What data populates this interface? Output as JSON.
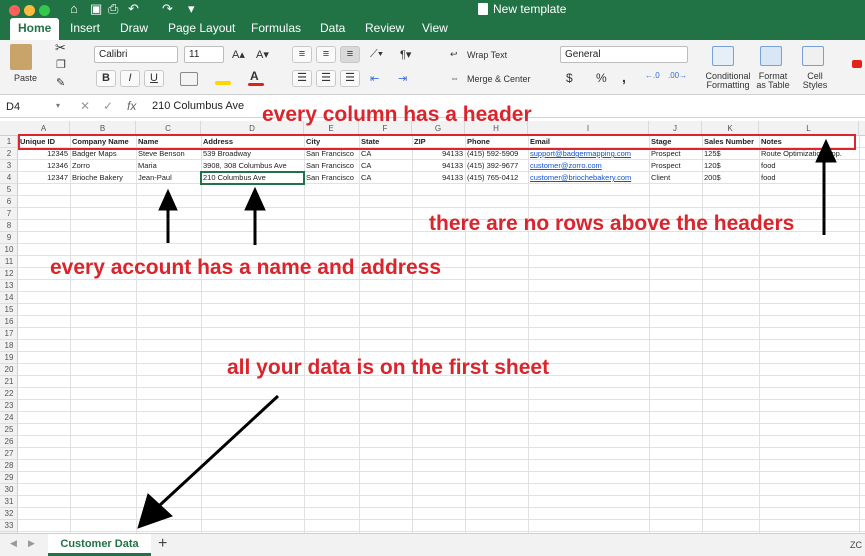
{
  "window": {
    "title": "New template",
    "tabs": [
      {
        "label": "Home",
        "active": true
      },
      {
        "label": "Insert"
      },
      {
        "label": "Draw"
      },
      {
        "label": "Page Layout"
      },
      {
        "label": "Formulas"
      },
      {
        "label": "Data"
      },
      {
        "label": "Review"
      },
      {
        "label": "View"
      }
    ]
  },
  "ribbon": {
    "paste_label": "Paste",
    "font_name": "Calibri",
    "font_size": "11",
    "bold": "B",
    "italic": "I",
    "underline": "U",
    "wrap_text": "Wrap Text",
    "merge_center": "Merge & Center",
    "number_format": "General",
    "currency": "$",
    "percent": "%",
    "comma": ",",
    "conditional_formatting": "Conditional Formatting",
    "format_as_table": "Format as Table",
    "cell_styles": "Cell Styles",
    "icons": [
      "paste-icon",
      "cut-icon",
      "copy-icon",
      "format-painter-icon",
      "fill-color-icon",
      "font-color-icon",
      "align-left-icon",
      "align-center-icon",
      "align-right-icon"
    ]
  },
  "formula_bar": {
    "name_box": "D4",
    "fx": "fx",
    "value": "210 Columbus Ave"
  },
  "sheet": {
    "columns": [
      "A",
      "B",
      "C",
      "D",
      "E",
      "F",
      "G",
      "H",
      "I",
      "J",
      "K",
      "L"
    ],
    "row_numbers": [
      "1",
      "2",
      "3",
      "4",
      "5",
      "6",
      "7",
      "8",
      "9",
      "10",
      "11",
      "12",
      "13",
      "14",
      "15",
      "16",
      "17",
      "18",
      "19",
      "20",
      "21",
      "22",
      "23",
      "24",
      "25",
      "26",
      "27",
      "28",
      "29",
      "30",
      "31",
      "32",
      "33",
      "34"
    ],
    "headers": [
      "Unique ID",
      "Company Name",
      "Name",
      "Address",
      "City",
      "State",
      "ZIP",
      "Phone",
      "Email",
      "Stage",
      "Sales Number",
      "Notes"
    ],
    "rows": [
      [
        "12345",
        "Badger Maps",
        "Steve Benson",
        "539 Broadway",
        "San Francisco",
        "CA",
        "94133",
        "(415) 592-5909",
        "support@badgermapping.com",
        "Prospect",
        "125$",
        "Route Optimization App."
      ],
      [
        "12346",
        "Zorro",
        "Maria",
        "3908, 308 Columbus Ave",
        "San Francisco",
        "CA",
        "94133",
        "(415) 392-9677",
        "customer@zorro.com",
        "Prospect",
        "120$",
        "food"
      ],
      [
        "12347",
        "Brioche Bakery",
        "Jean-Paul",
        "210 Columbus Ave",
        "San Francisco",
        "CA",
        "94133",
        "(415) 765-0412",
        "customer@briochebakery.com",
        "Client",
        "200$",
        "food"
      ]
    ],
    "tab_name": "Customer Data",
    "zoom_label": "ZC"
  },
  "annotations": {
    "header": "every column has a header",
    "no_rows_above": "there are no rows above the headers",
    "name_address": "every account has a name and address",
    "first_sheet": "all your data is on the first sheet",
    "color": "#d9252b"
  },
  "colors": {
    "excel_green": "#217346",
    "link_blue": "#1155cc"
  }
}
